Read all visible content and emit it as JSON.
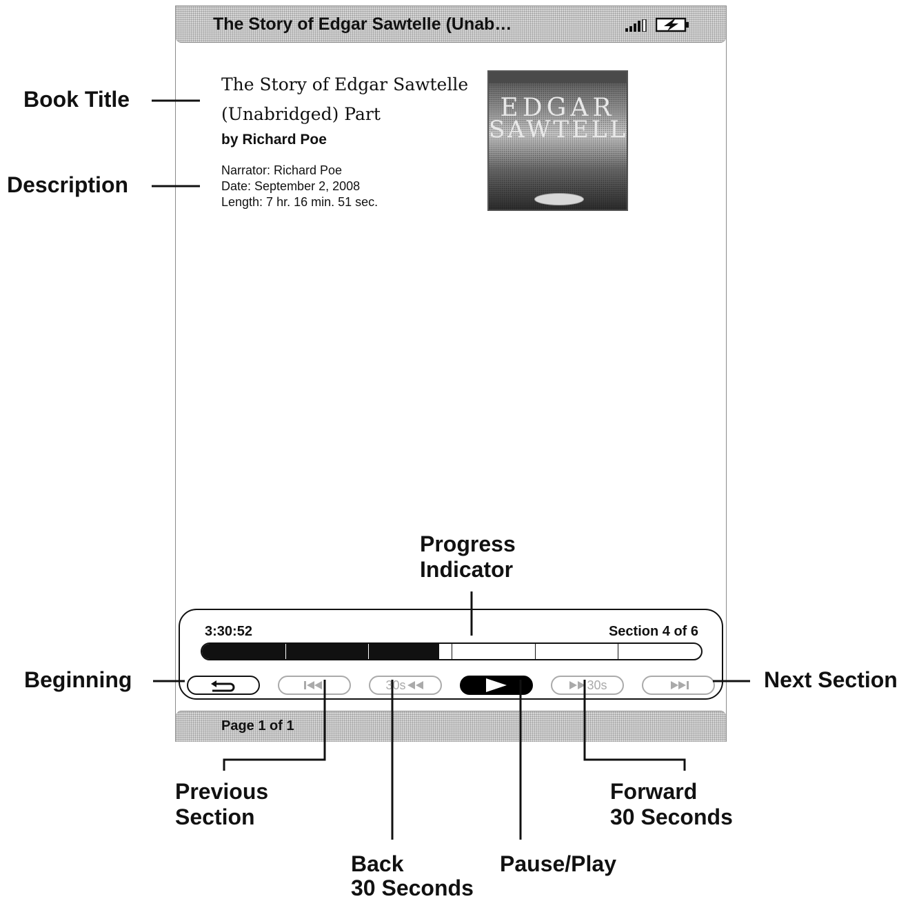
{
  "device": {
    "title_bar": {
      "title": "The Story of Edgar Sawtelle (Unab…",
      "signal_icon": "signal-strength-icon",
      "battery_icon": "battery-charging-icon"
    },
    "book": {
      "title": "The Story of Edgar Sawtelle (Unabridged) Part",
      "author": "by Richard Poe",
      "narrator": "Narrator: Richard Poe",
      "date": "Date: September 2, 2008",
      "length": "Length: 7 hr. 16 min. 51 sec.",
      "cover_line1": "EDGAR",
      "cover_line2": "SAWTELLE"
    },
    "player": {
      "elapsed": "3:30:52",
      "section": "Section 4 of 6",
      "progress_fraction": 0.475,
      "sections_total": 6,
      "buttons": {
        "beginning_icon": "return-to-beginning-icon",
        "prev_icon": "previous-section-icon",
        "back30_label": "30s",
        "back30_icon": "rewind-icon",
        "play_icon": "play-icon",
        "fwd30_label": "30s",
        "fwd30_icon": "fast-forward-icon",
        "next_icon": "next-section-icon"
      }
    },
    "status_bar": {
      "page": "Page 1 of 1"
    }
  },
  "callouts": {
    "book_title": "Book Title",
    "description": "Description",
    "progress_indicator_line1": "Progress",
    "progress_indicator_line2": "Indicator",
    "beginning": "Beginning",
    "next_section": "Next Section",
    "previous_section_line1": "Previous",
    "previous_section_line2": "Section",
    "forward_line1": "Forward",
    "forward_line2": "30 Seconds",
    "back_line1": "Back",
    "back_line2": "30 Seconds",
    "pause_play": "Pause/Play"
  }
}
